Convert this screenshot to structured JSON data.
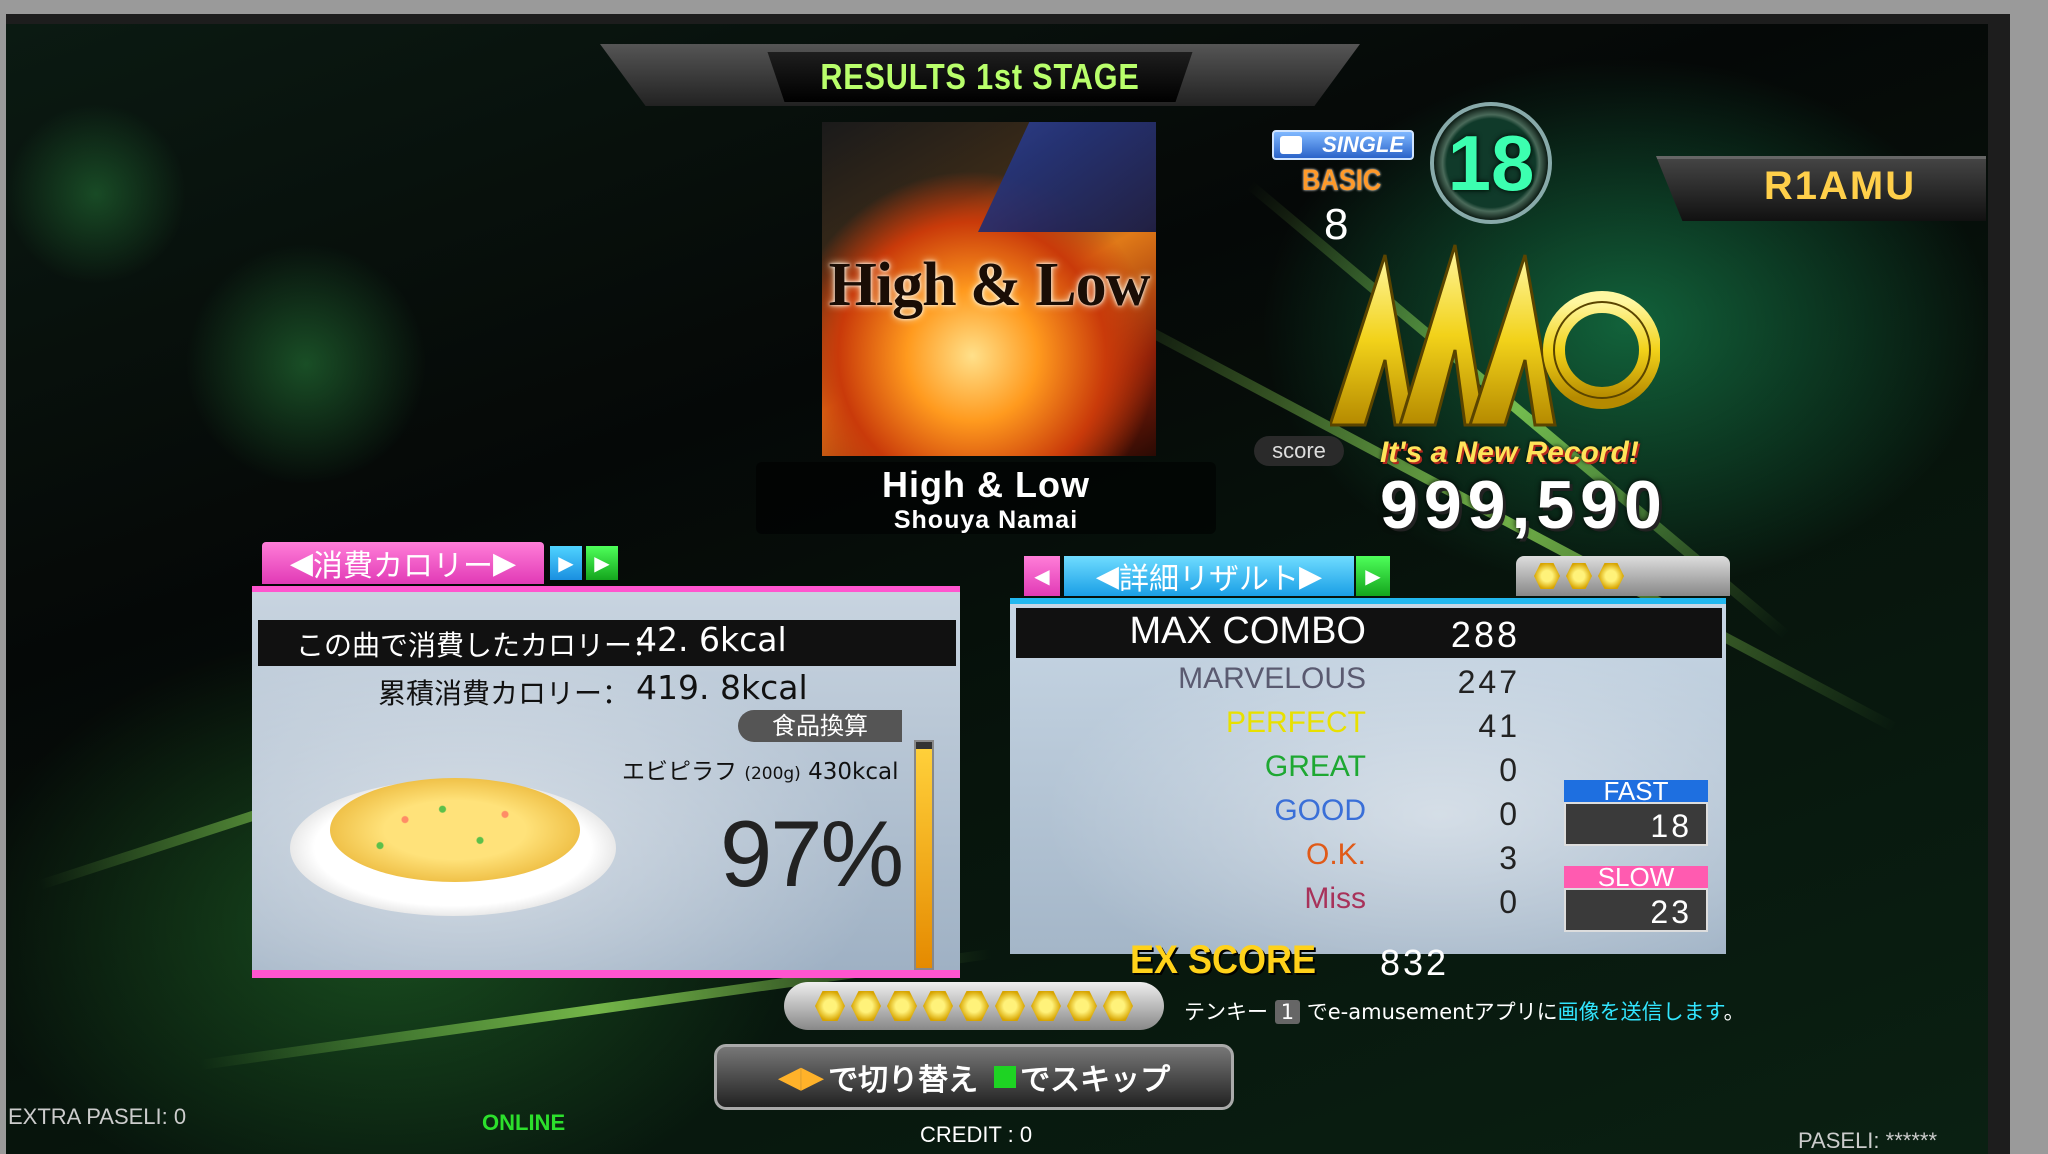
{
  "header": {
    "stage_title": "RESULTS 1st STAGE"
  },
  "song": {
    "jacket_title": "High & Low",
    "title": "High & Low",
    "artist": "Shouya Namai"
  },
  "difficulty": {
    "style": "SINGLE",
    "name": "BASIC",
    "level": "18",
    "sub_level": "8",
    "colors": {
      "basic": "#ff9a2a",
      "level": "#3cffb0"
    }
  },
  "player": {
    "name": "R1AMU"
  },
  "grade": {
    "rank": "AAA",
    "full_combo": true
  },
  "score": {
    "label": "score",
    "new_record": "It's a New Record!",
    "value": "999,590"
  },
  "calorie": {
    "tab_label": "消費カロリー",
    "song_label": "この曲で消費したカロリー：",
    "song_value": "42. 6kcal",
    "total_label": "累積消費カロリー：",
    "total_value": "419. 8kcal",
    "food_tag": "食品換算",
    "food_name": "エビピラフ",
    "food_weight": "(200g)",
    "food_kcal": "430kcal",
    "percent_text": "97%",
    "percent": 97
  },
  "details": {
    "tab_label": "詳細リザルト",
    "stars": 3,
    "max_combo": {
      "label": "MAX COMBO",
      "value": "288"
    },
    "judgments": [
      {
        "label": "MARVELOUS",
        "value": "247",
        "color": "#5a5a70"
      },
      {
        "label": "PERFECT",
        "value": "41",
        "color": "#e8e000"
      },
      {
        "label": "GREAT",
        "value": "0",
        "color": "#1ea832"
      },
      {
        "label": "GOOD",
        "value": "0",
        "color": "#3a6fd8"
      },
      {
        "label": "O.K.",
        "value": "3",
        "color": "#e05a18"
      },
      {
        "label": "Miss",
        "value": "0",
        "color": "#a8325a"
      }
    ],
    "fast": {
      "label": "FAST",
      "value": "18"
    },
    "slow": {
      "label": "SLOW",
      "value": "23"
    },
    "ex_score": {
      "label": "EX SCORE",
      "value": "832"
    }
  },
  "gems": 9,
  "send_hint": {
    "prefix": "テンキー",
    "key": "1",
    "middle": "でe-amusementアプリに",
    "highlight": "画像を送信します",
    "suffix": "。"
  },
  "controls": {
    "switch": "で切り替え",
    "skip": "でスキップ"
  },
  "footer": {
    "extra_paseli": "EXTRA PASELI: 0",
    "online": "ONLINE",
    "credit": "CREDIT : 0",
    "paseli": "PASELI: ******"
  }
}
